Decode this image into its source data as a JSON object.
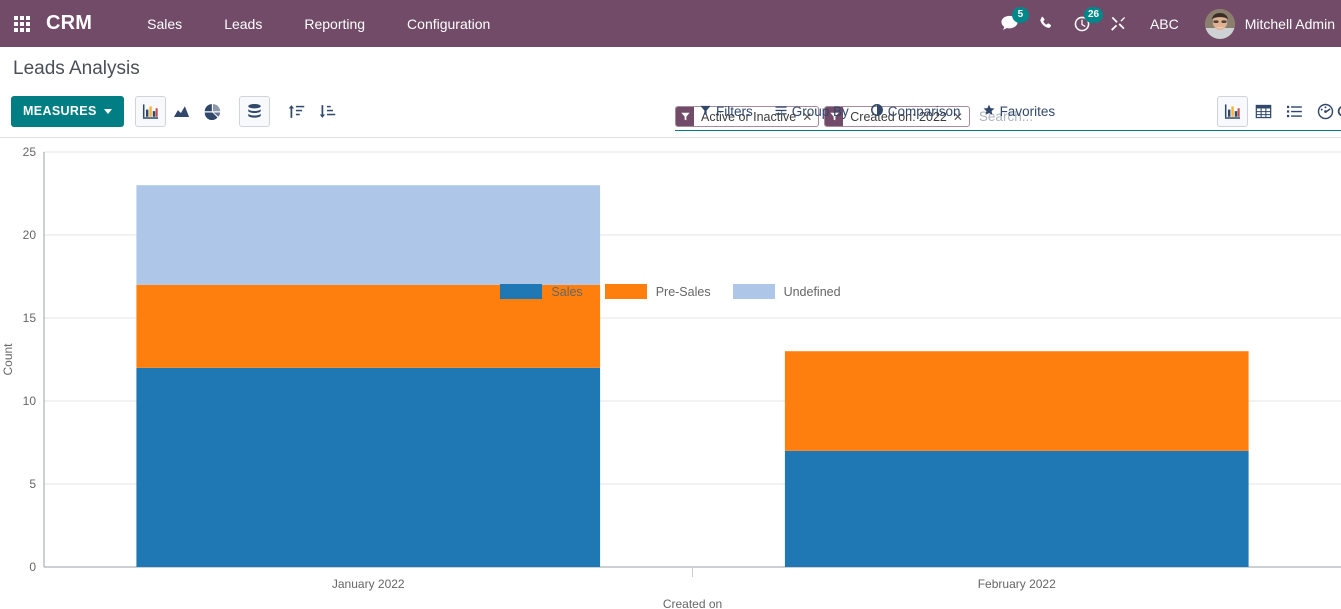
{
  "navbar": {
    "brand": "CRM",
    "apps_icon": "apps-grid-icon",
    "menu_items": [
      {
        "label": "Sales"
      },
      {
        "label": "Leads"
      },
      {
        "label": "Reporting"
      },
      {
        "label": "Configuration"
      }
    ],
    "messages_badge": "5",
    "activities_badge": "26",
    "debug_label": "ABC",
    "user_name": "Mitchell Admin",
    "background_color": "#714b67",
    "badge_color": "#00878a"
  },
  "control_panel": {
    "title": "Leads Analysis",
    "search": {
      "placeholder": "Search...",
      "facets": [
        {
          "label": "Active or Inactive",
          "remove": "✕"
        },
        {
          "label": "Created on: 2022",
          "remove": "✕"
        }
      ]
    },
    "measures_label": "MEASURES",
    "chart_type_buttons": [
      {
        "name": "bar-chart",
        "active": true
      },
      {
        "name": "line-chart",
        "active": false
      },
      {
        "name": "pie-chart",
        "active": false
      }
    ],
    "stack_button": {
      "name": "stacked-bars",
      "active": true
    },
    "sort_buttons": [
      {
        "name": "sort-ascending"
      },
      {
        "name": "sort-descending"
      }
    ],
    "dropdowns": [
      {
        "label": "Filters",
        "icon": "filter-icon"
      },
      {
        "label": "Group By",
        "icon": "list-lines-icon"
      },
      {
        "label": "Comparison",
        "icon": "half-circle-icon"
      },
      {
        "label": "Favorites",
        "icon": "star-icon"
      }
    ],
    "views": [
      {
        "name": "graph-view",
        "active": true
      },
      {
        "name": "pivot-view",
        "active": false
      },
      {
        "name": "list-view",
        "active": false
      },
      {
        "name": "dashboard-view",
        "active": false
      }
    ],
    "accent_color": "#017e84"
  },
  "chart_data": {
    "type": "bar",
    "stacked": true,
    "title": "",
    "xlabel": "Created on",
    "ylabel": "Count",
    "categories": [
      "January 2022",
      "February 2022"
    ],
    "series": [
      {
        "name": "Sales",
        "color": "#1f77b4",
        "values": [
          12,
          7
        ]
      },
      {
        "name": "Pre-Sales",
        "color": "#ff7f0e",
        "values": [
          5,
          6
        ]
      },
      {
        "name": "Undefined",
        "color": "#aec7e8",
        "values": [
          6,
          0
        ]
      }
    ],
    "totals": [
      23,
      13
    ],
    "ylim": [
      0,
      25
    ],
    "yticks": [
      0,
      5,
      10,
      15,
      20,
      25
    ],
    "grid": true,
    "legend_position": "top"
  }
}
